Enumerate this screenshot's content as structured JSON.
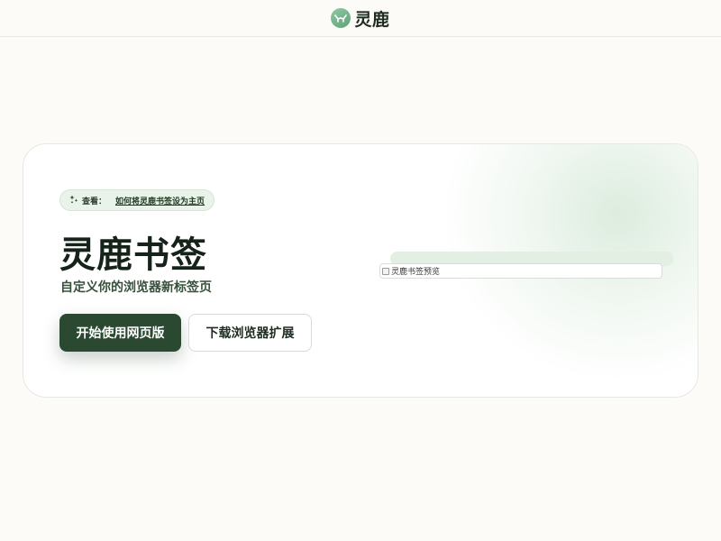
{
  "header": {
    "brand_name": "灵鹿",
    "logo_icon": "deer-antler-icon",
    "logo_color": "#6fb088"
  },
  "hero": {
    "notice": {
      "label": "查看：",
      "link_text": "如何将灵鹿书签设为主页",
      "icon": "sparkle-icon"
    },
    "title": "灵鹿书签",
    "subtitle": "自定义你的浏览器新标签页",
    "primary_button": "开始使用网页版",
    "secondary_button": "下载浏览器扩展",
    "preview_alt": "灵鹿书签预览"
  },
  "colors": {
    "accent": "#2b4930",
    "background": "#fcfbf7",
    "notice_bg": "#eaf3ea"
  }
}
